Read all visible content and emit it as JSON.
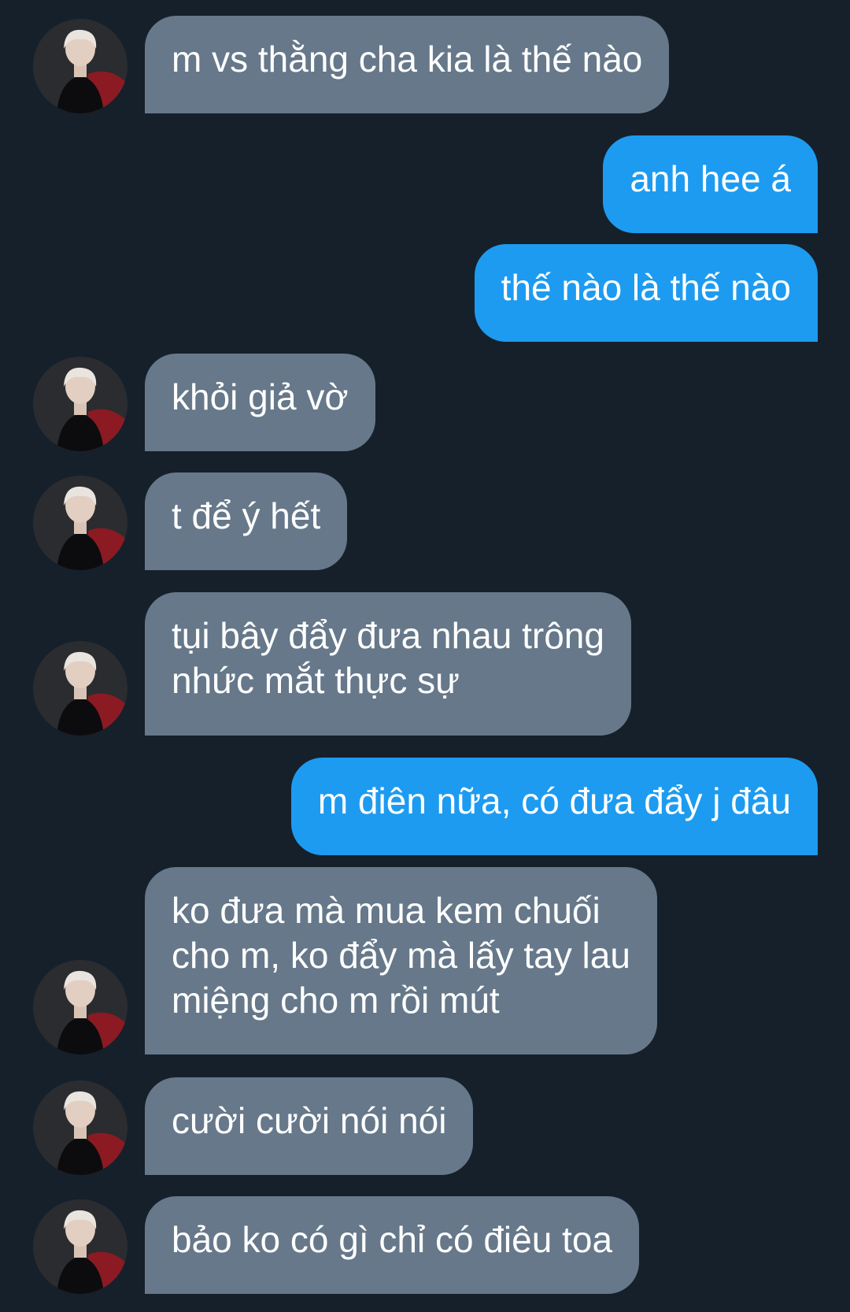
{
  "conversation": {
    "messages": [
      {
        "sender": "them",
        "text": "m vs thằng cha kia là thế nào"
      },
      {
        "sender": "me",
        "text": "anh hee á"
      },
      {
        "sender": "me",
        "text": "thế nào là thế nào"
      },
      {
        "sender": "them",
        "text": "khỏi giả vờ"
      },
      {
        "sender": "them",
        "text": "t để ý hết"
      },
      {
        "sender": "them",
        "text": "tụi bây đẩy đưa nhau trông\nnhức mắt thực sự"
      },
      {
        "sender": "me",
        "text": "m điên nữa, có đưa đẩy j đâu"
      },
      {
        "sender": "them",
        "text": "ko đưa mà mua kem chuối\ncho m, ko đẩy mà lấy tay lau\nmiệng cho m rồi mút"
      },
      {
        "sender": "them",
        "text": "cười cười nói nói"
      },
      {
        "sender": "them",
        "text": "bảo ko có gì chỉ có điêu toa"
      }
    ]
  },
  "colors": {
    "background": "#16202b",
    "incoming_bubble": "#66788a",
    "outgoing_bubble": "#1d9bf0",
    "text": "#ffffff"
  },
  "icons": {
    "sender_avatar": "profile-photo-avatar"
  }
}
